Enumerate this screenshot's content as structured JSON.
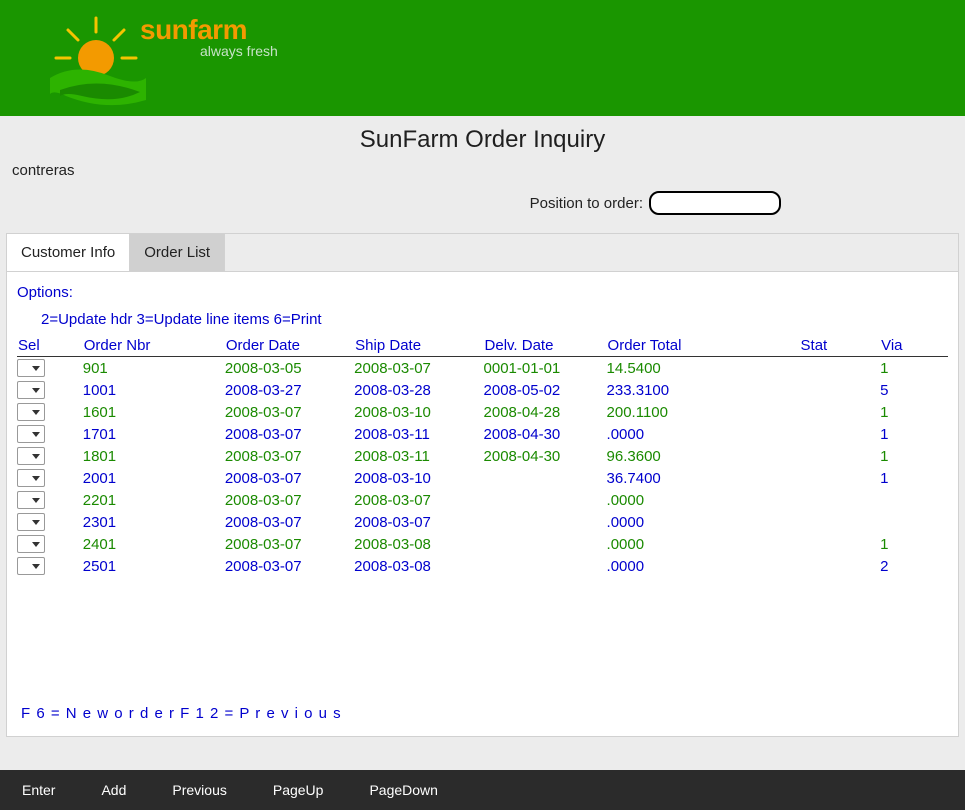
{
  "brand": {
    "name": "sunfarm",
    "tagline": "always fresh"
  },
  "page": {
    "title": "SunFarm Order Inquiry",
    "user": "contreras",
    "position_label": "Position to order:",
    "position_value": ""
  },
  "tabs": {
    "customer_info": "Customer Info",
    "order_list": "Order List",
    "active": "order_list"
  },
  "options": {
    "label": "Options:",
    "hint": "2=Update hdr  3=Update line items  6=Print"
  },
  "columns": {
    "sel": "Sel",
    "order_nbr": "Order Nbr",
    "order_date": "Order Date",
    "ship_date": "Ship Date",
    "delv_date": "Delv. Date",
    "order_total": "Order Total",
    "stat": "Stat",
    "via": "Via"
  },
  "rows": [
    {
      "color": "green",
      "order_nbr": "901",
      "order_date": "2008-03-05",
      "ship_date": "2008-03-07",
      "delv_date": "0001-01-01",
      "order_total": "14.5400",
      "stat": "",
      "via": "1"
    },
    {
      "color": "blue",
      "order_nbr": "1001",
      "order_date": "2008-03-27",
      "ship_date": "2008-03-28",
      "delv_date": "2008-05-02",
      "order_total": "233.3100",
      "stat": "",
      "via": "5"
    },
    {
      "color": "green",
      "order_nbr": "1601",
      "order_date": "2008-03-07",
      "ship_date": "2008-03-10",
      "delv_date": "2008-04-28",
      "order_total": "200.1100",
      "stat": "",
      "via": "1"
    },
    {
      "color": "blue",
      "order_nbr": "1701",
      "order_date": "2008-03-07",
      "ship_date": "2008-03-11",
      "delv_date": "2008-04-30",
      "order_total": ".0000",
      "stat": "",
      "via": "1"
    },
    {
      "color": "green",
      "order_nbr": "1801",
      "order_date": "2008-03-07",
      "ship_date": "2008-03-11",
      "delv_date": "2008-04-30",
      "order_total": "96.3600",
      "stat": "",
      "via": "1"
    },
    {
      "color": "blue",
      "order_nbr": "2001",
      "order_date": "2008-03-07",
      "ship_date": "2008-03-10",
      "delv_date": "",
      "order_total": "36.7400",
      "stat": "",
      "via": "1"
    },
    {
      "color": "green",
      "order_nbr": "2201",
      "order_date": "2008-03-07",
      "ship_date": "2008-03-07",
      "delv_date": "",
      "order_total": ".0000",
      "stat": "",
      "via": ""
    },
    {
      "color": "blue",
      "order_nbr": "2301",
      "order_date": "2008-03-07",
      "ship_date": "2008-03-07",
      "delv_date": "",
      "order_total": ".0000",
      "stat": "",
      "via": ""
    },
    {
      "color": "green",
      "order_nbr": "2401",
      "order_date": "2008-03-07",
      "ship_date": "2008-03-08",
      "delv_date": "",
      "order_total": ".0000",
      "stat": "",
      "via": "1"
    },
    {
      "color": "blue",
      "order_nbr": "2501",
      "order_date": "2008-03-07",
      "ship_date": "2008-03-08",
      "delv_date": "",
      "order_total": ".0000",
      "stat": "",
      "via": "2"
    }
  ],
  "fnkeys": "F 6 = N e w   o r d e r       F 1 2 = P r e v i o u s",
  "actions": {
    "enter": "Enter",
    "add": "Add",
    "previous": "Previous",
    "pageup": "PageUp",
    "pagedown": "PageDown"
  }
}
